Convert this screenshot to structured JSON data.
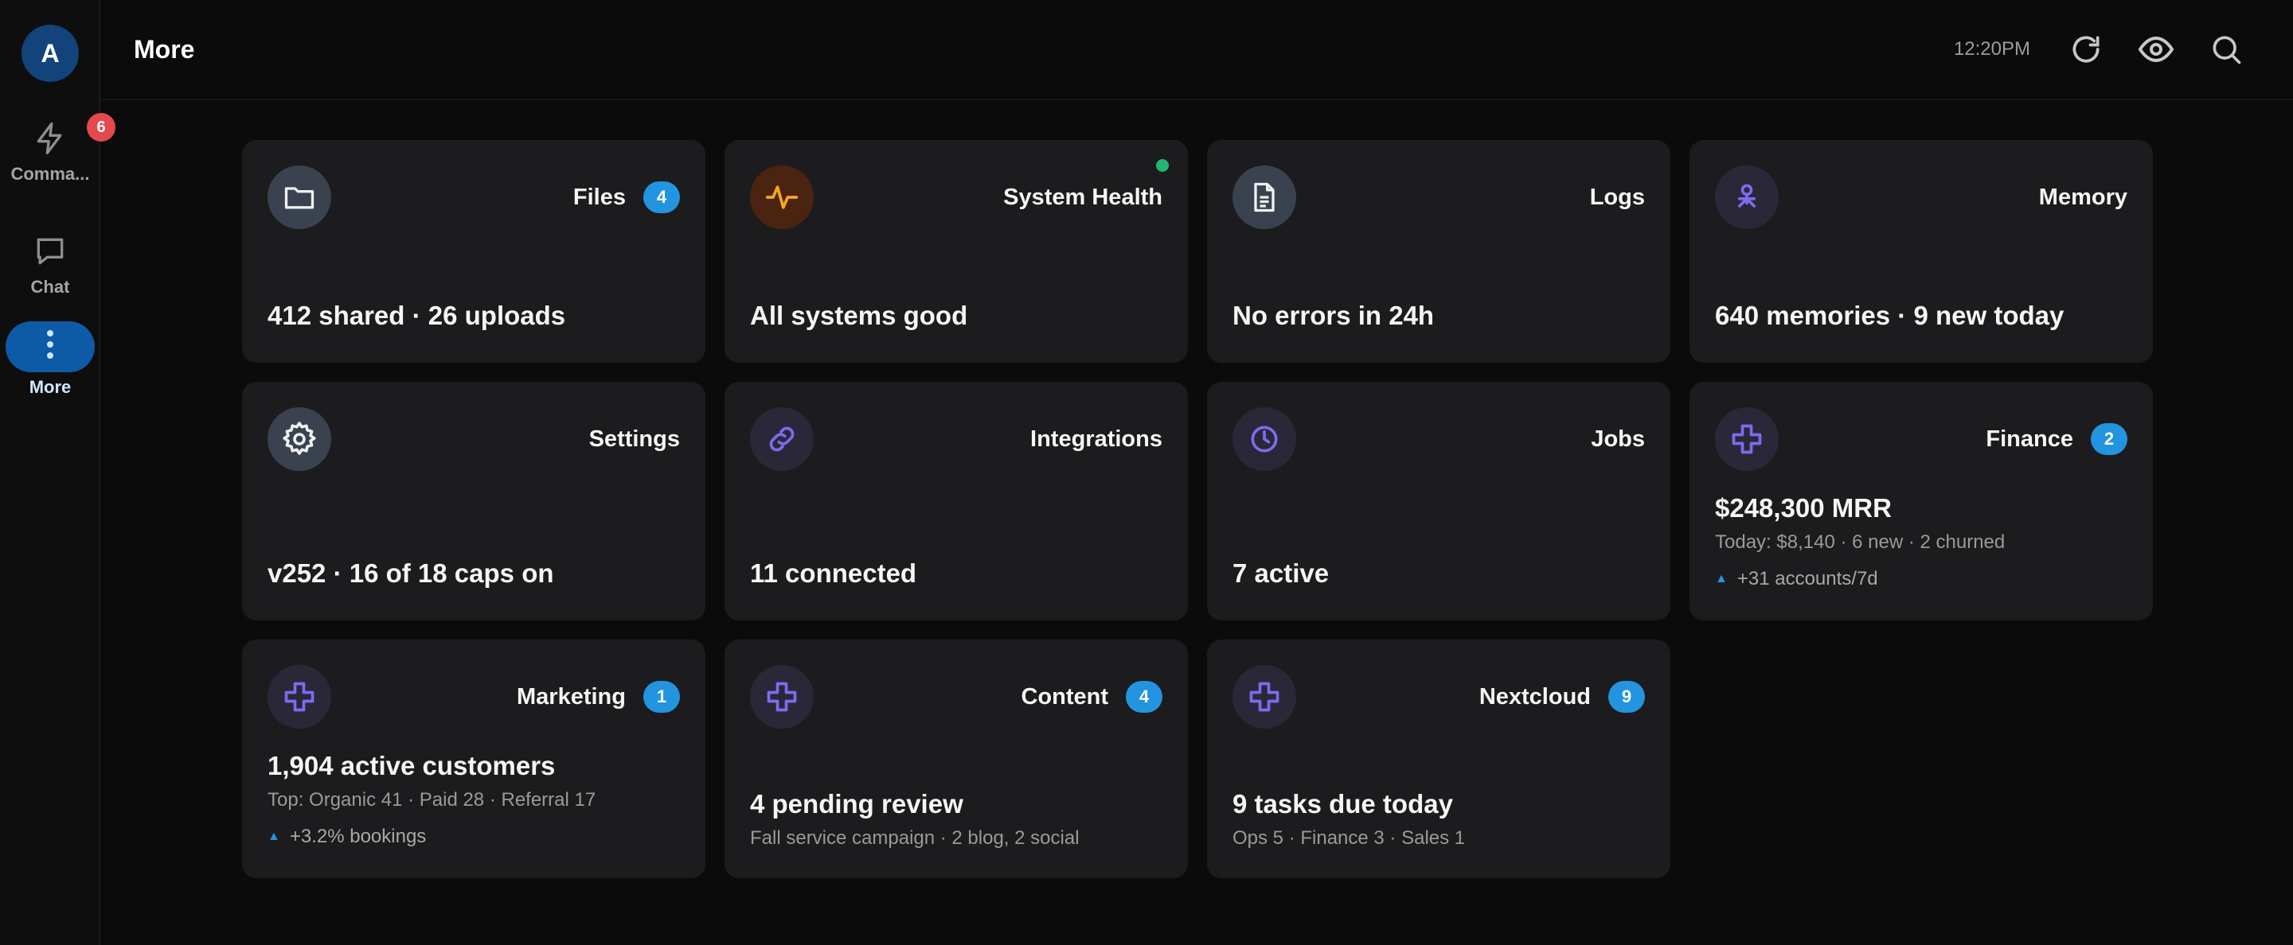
{
  "sidebar": {
    "avatar_letter": "A",
    "items": [
      {
        "label": "Comma...",
        "badge": "6"
      },
      {
        "label": "Chat"
      },
      {
        "label": "More"
      }
    ]
  },
  "header": {
    "title": "More",
    "time": "12:20PM"
  },
  "cards": {
    "files": {
      "title": "Files",
      "badge": "4",
      "main": "412 shared · 26 uploads",
      "icon": "folder-icon"
    },
    "health": {
      "title": "System Health",
      "main": "All systems good",
      "icon": "activity-icon",
      "status_color": "#22b573"
    },
    "logs": {
      "title": "Logs",
      "main": "No errors in 24h",
      "icon": "document-icon"
    },
    "memory": {
      "title": "Memory",
      "main": "640 memories · 9 new today",
      "icon": "person-node-icon"
    },
    "settings": {
      "title": "Settings",
      "main": "v252 · 16 of 18 caps on",
      "icon": "gear-icon"
    },
    "integrations": {
      "title": "Integrations",
      "main": "11 connected",
      "icon": "link-icon"
    },
    "jobs": {
      "title": "Jobs",
      "main": "7 active",
      "icon": "clock-icon"
    },
    "finance": {
      "title": "Finance",
      "badge": "2",
      "main": "$248,300 MRR",
      "sub": "Today: $8,140 · 6 new · 2 churned",
      "trend": "+31 accounts/7d",
      "icon": "puzzle-icon"
    },
    "marketing": {
      "title": "Marketing",
      "badge": "1",
      "main": "1,904 active customers",
      "sub": "Top: Organic 41 · Paid 28 · Referral 17",
      "trend": "+3.2% bookings",
      "icon": "puzzle-icon"
    },
    "content": {
      "title": "Content",
      "badge": "4",
      "main": "4 pending review",
      "sub": "Fall service campaign · 2 blog, 2 social",
      "icon": "puzzle-icon"
    },
    "nextcloud": {
      "title": "Nextcloud",
      "badge": "9",
      "main": "9 tasks due today",
      "sub": "Ops 5 · Finance 3 · Sales 1",
      "icon": "puzzle-icon"
    }
  },
  "colors": {
    "accent": "#2394e0",
    "active_nav": "#0d5aa7",
    "alert": "#e5484d",
    "icon_violet": "#7b6cf0",
    "icon_orange": "#f5a623"
  }
}
